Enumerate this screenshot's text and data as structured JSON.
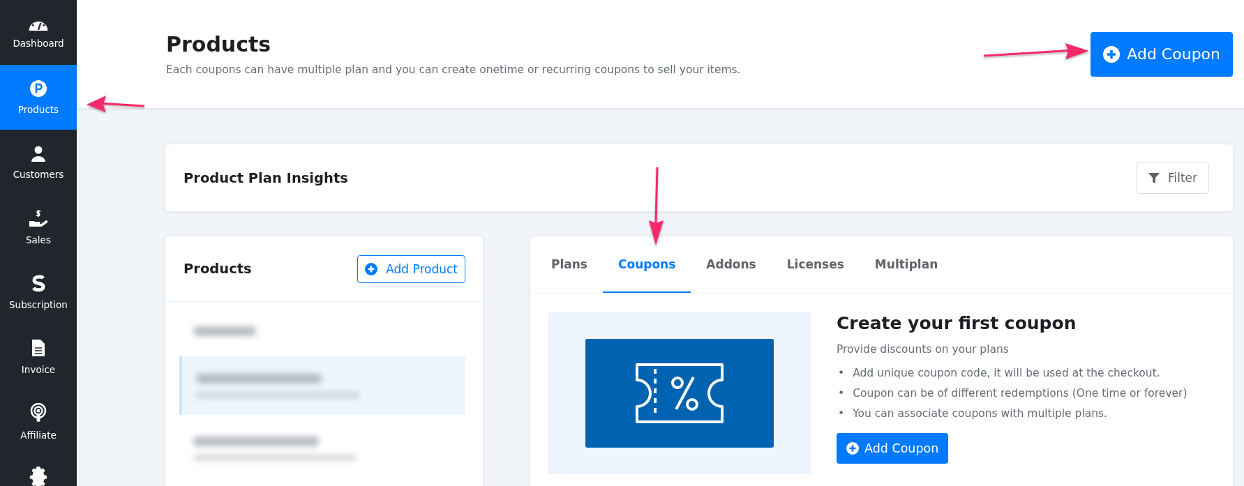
{
  "sidebar": {
    "items": [
      {
        "label": "Dashboard",
        "selected": false
      },
      {
        "label": "Products",
        "selected": true
      },
      {
        "label": "Customers",
        "selected": false
      },
      {
        "label": "Sales",
        "selected": false
      },
      {
        "label": "Subscription",
        "selected": false
      },
      {
        "label": "Invoice",
        "selected": false
      },
      {
        "label": "Affiliate",
        "selected": false
      }
    ]
  },
  "header": {
    "title": "Products",
    "subtitle": "Each coupons can have multiple plan and you can create onetime or recurring coupons to sell your items.",
    "button": "Add Coupon"
  },
  "insights": {
    "title": "Product Plan Insights",
    "filter": "Filter"
  },
  "products_panel": {
    "title": "Products",
    "button": "Add Product",
    "rows": [
      {
        "kind": "count",
        "selected": false
      },
      {
        "kind": "product",
        "selected": true
      },
      {
        "kind": "product",
        "selected": false
      }
    ]
  },
  "tabs": [
    {
      "label": "Plans",
      "selected": false
    },
    {
      "label": "Coupons",
      "selected": true
    },
    {
      "label": "Addons",
      "selected": false
    },
    {
      "label": "Licenses",
      "selected": false
    },
    {
      "label": "Multiplan",
      "selected": false
    }
  ],
  "empty_state": {
    "title": "Create your first coupon",
    "subtitle": "Provide discounts on your plans",
    "bullets": [
      {
        "marker": "•",
        "text": "Add unique coupon code, it will be used at the checkout."
      },
      {
        "marker": "•",
        "text": "Coupon can be of different redemptions (One time or forever)"
      },
      {
        "marker": "•",
        "text": "You can associate coupons with multiple plans."
      }
    ],
    "button": "Add Coupon"
  }
}
